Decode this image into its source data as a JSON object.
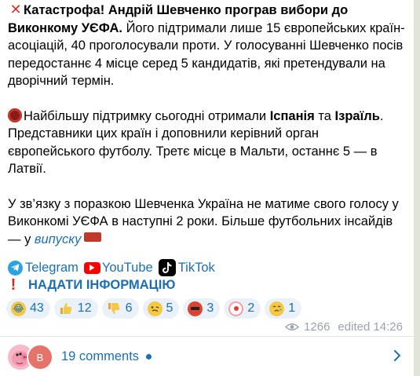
{
  "post": {
    "p1": {
      "headline_bold": "Катастрофа! Андрій Шевченко програв вибори до Виконкому УЄФА.",
      "body": " Його підтримали лише 15 європейських країн-асоціацій, 40 проголосували проти. У голосуванні Шевченко посів передостаннє 4 місце серед 5 кандидатів, які претендували на дворічний термін."
    },
    "p2": {
      "intro_bold": "Найбільшу підтримку сьогодні отримали",
      "country1": "Іспанія",
      "connector": "та",
      "country2": "Ізраїль",
      "rest": ". Представники цих країн і доповнили керівний орган європейського футболу. Третє місце в Мальти, останнє 5 — в Латвії."
    },
    "p3": {
      "text": "У зв’язку з поразкою Шевченка Україна не матиме свого голосу у Виконкомі УЄФА в наступні 2 роки. Більше футбольних інсайдів — у ",
      "link": "випуску"
    },
    "socials": [
      {
        "label": "Telegram",
        "icon": "telegram-icon"
      },
      {
        "label": "YouTube",
        "icon": "youtube-icon"
      },
      {
        "label": "TikTok",
        "icon": "tiktok-icon"
      }
    ],
    "inform_label": "НАДАТИ ІНФОРМАЦІЮ",
    "reactions": [
      {
        "emoji": "rofl",
        "count": "43"
      },
      {
        "emoji": "thumbs-up",
        "count": "12"
      },
      {
        "emoji": "thumbs-down",
        "count": "6"
      },
      {
        "emoji": "woozy-face",
        "count": "5"
      },
      {
        "emoji": "cursing-face",
        "count": "3"
      },
      {
        "emoji": "clown-face",
        "count": "2"
      },
      {
        "emoji": "crying-face",
        "count": "1"
      }
    ],
    "views": "1266",
    "edited": "edited 14:26"
  },
  "comments": {
    "label": "19 comments",
    "avatar_letter": "В"
  },
  "colors": {
    "link": "#1b6fb5",
    "reaction_bg": "#eaf1f8",
    "meta": "#9aa3ad",
    "side": "#dfe6d8"
  }
}
